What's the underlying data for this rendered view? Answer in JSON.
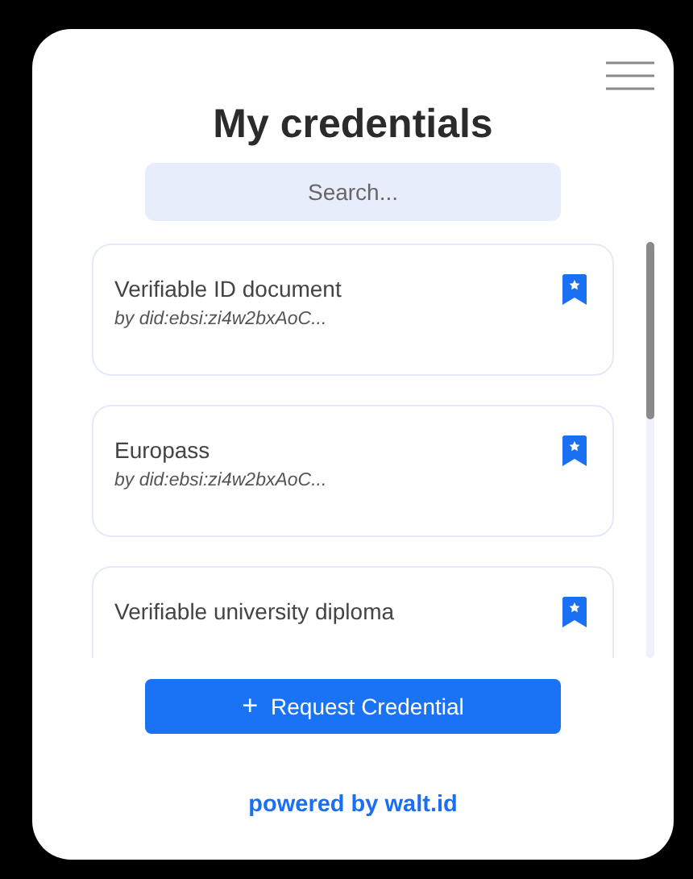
{
  "title": "My credentials",
  "search": {
    "placeholder": "Search..."
  },
  "credentials": [
    {
      "name": "Verifiable ID document",
      "issuer": "by did:ebsi:zi4w2bxAoC..."
    },
    {
      "name": "Europass",
      "issuer": "by did:ebsi:zi4w2bxAoC..."
    },
    {
      "name": "Verifiable university diploma"
    }
  ],
  "request_button": {
    "icon": "+",
    "label": "Request Credential"
  },
  "footer": "powered by walt.id"
}
